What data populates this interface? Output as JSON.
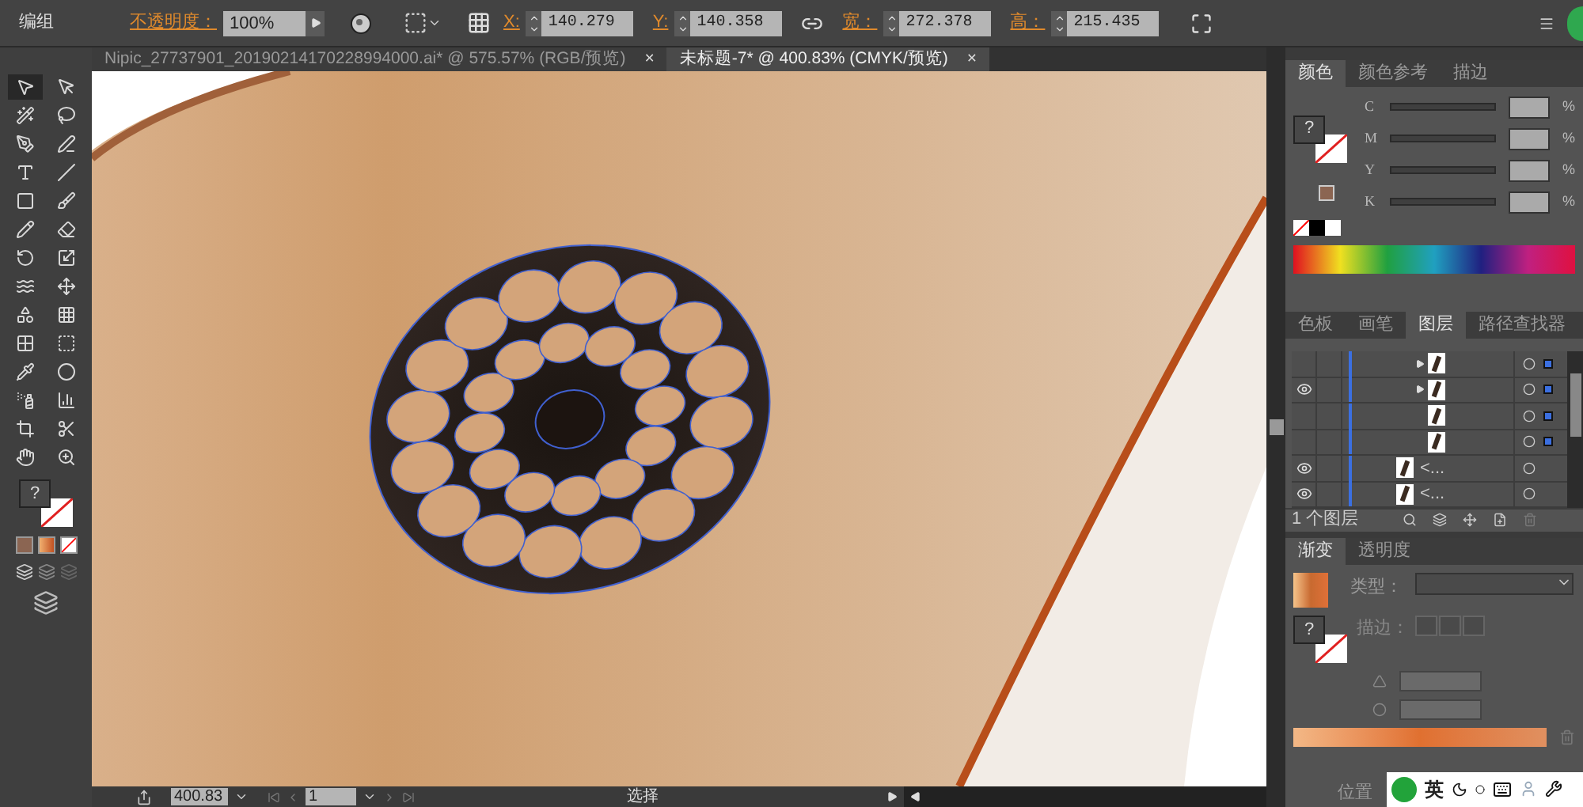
{
  "control_bar": {
    "selection_label": "编组",
    "opacity_label": "不透明度：",
    "opacity_value": "100%",
    "fields": [
      {
        "label": "X:",
        "value": "140.279"
      },
      {
        "label": "Y:",
        "value": "140.358"
      },
      {
        "label": "宽：",
        "value": "272.378"
      },
      {
        "label": "高：",
        "value": "215.435"
      }
    ]
  },
  "document_tabs": [
    {
      "title": "Nipic_27737901_20190214170228994000.ai* @ 575.57% (RGB/预览)",
      "selected": false,
      "close": "×"
    },
    {
      "title": "未标题-7* @ 400.83% (CMYK/预览)",
      "selected": true,
      "close": "×"
    }
  ],
  "toolbar": {
    "tools": [
      {
        "selected": true
      },
      {
        "selected": false
      },
      {
        "selected": false
      },
      {
        "selected": false
      },
      {
        "selected": false
      },
      {
        "selected": false
      },
      {
        "selected": false
      },
      {
        "selected": false
      },
      {
        "selected": false
      },
      {
        "selected": false
      },
      {
        "selected": false
      },
      {
        "selected": false
      },
      {
        "selected": false
      },
      {
        "selected": false
      },
      {
        "selected": false
      },
      {
        "selected": false
      },
      {
        "selected": false
      },
      {
        "selected": false
      },
      {
        "selected": false
      },
      {
        "selected": false
      },
      {
        "selected": false
      },
      {
        "selected": false
      },
      {
        "selected": false
      },
      {
        "selected": false
      },
      {
        "selected": false
      },
      {
        "selected": false
      },
      {
        "selected": false
      },
      {
        "selected": false
      }
    ],
    "fill_mark": "?"
  },
  "color_panel": {
    "tabs": [
      {
        "label": "颜色",
        "selected": true
      },
      {
        "label": "颜色参考",
        "selected": false
      },
      {
        "label": "描边",
        "selected": false
      }
    ],
    "fill_mark": "?",
    "channels": [
      {
        "name": "C",
        "unit": "%"
      },
      {
        "name": "M",
        "unit": "%"
      },
      {
        "name": "Y",
        "unit": "%"
      },
      {
        "name": "K",
        "unit": "%"
      }
    ]
  },
  "layers_panel": {
    "tabs": [
      {
        "label": "色板",
        "selected": false
      },
      {
        "label": "画笔",
        "selected": false
      },
      {
        "label": "图层",
        "selected": true
      },
      {
        "label": "路径查找器",
        "selected": false
      }
    ],
    "rows": [
      {
        "visible": false,
        "expandable": true,
        "has_marker": true
      },
      {
        "visible": true,
        "expandable": true,
        "has_marker": true
      },
      {
        "visible": false,
        "expandable": false,
        "has_marker": true
      },
      {
        "visible": false,
        "expandable": false,
        "has_marker": true
      },
      {
        "visible": true,
        "expandable": false,
        "has_marker": false,
        "name": "<..."
      },
      {
        "visible": true,
        "expandable": false,
        "has_marker": false,
        "name": "<..."
      }
    ],
    "footer": "1 个图层"
  },
  "gradient_panel": {
    "tabs": [
      {
        "label": "渐变",
        "selected": true
      },
      {
        "label": "透明度",
        "selected": false
      }
    ],
    "fill_mark": "?",
    "type_label": "类型：",
    "stroke_label": "描边：",
    "position_label": "位置"
  },
  "status_bar": {
    "zoom": "400.83",
    "artboard": "1",
    "tool": "选择"
  },
  "ime_bar": {
    "language": "英"
  }
}
